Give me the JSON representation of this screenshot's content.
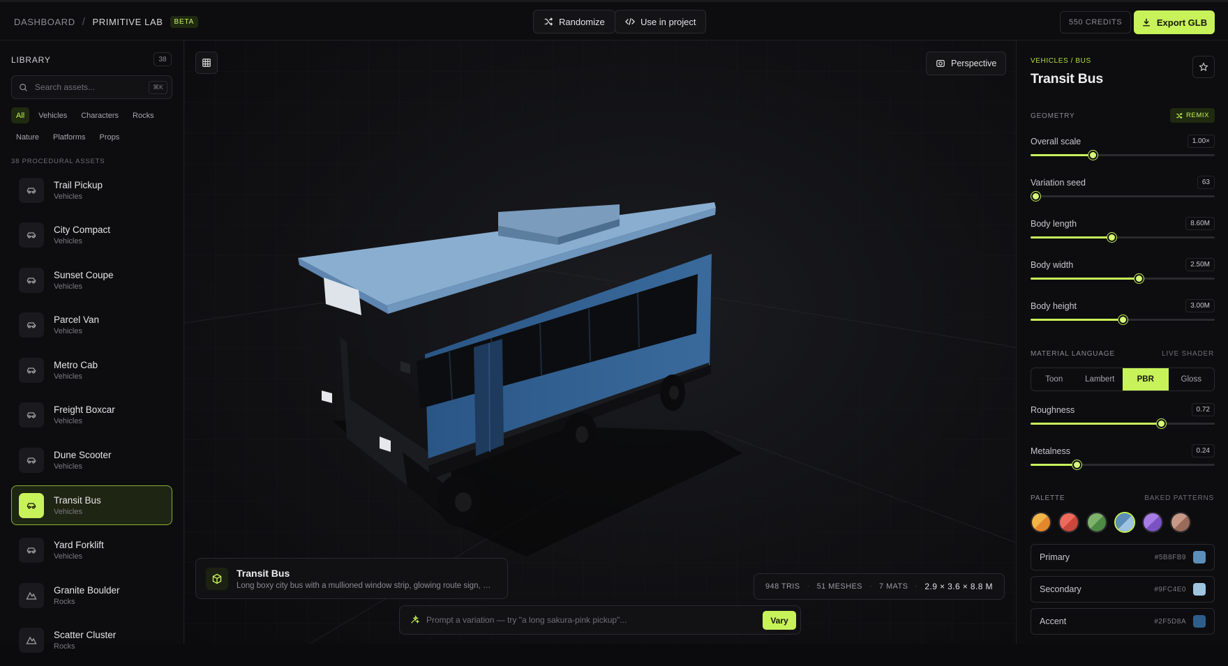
{
  "header": {
    "breadcrumb_root": "DASHBOARD",
    "breadcrumb_current": "PRIMITIVE LAB",
    "badge": "BETA",
    "randomize_label": "Randomize",
    "use_in_project_label": "Use in project",
    "credits": "550 CREDITS",
    "export_label": "Export GLB"
  },
  "library": {
    "title": "LIBRARY",
    "count": "38",
    "search_placeholder": "Search assets...",
    "search_shortcut": "⌘K",
    "filters": [
      {
        "label": "All",
        "active": true
      },
      {
        "label": "Vehicles"
      },
      {
        "label": "Characters"
      },
      {
        "label": "Rocks"
      },
      {
        "label": "Nature"
      },
      {
        "label": "Platforms"
      },
      {
        "label": "Props"
      }
    ],
    "assets_heading": "38 PROCEDURAL ASSETS",
    "assets": [
      {
        "name": "Trail Pickup",
        "category": "Vehicles",
        "icon": "car-icon"
      },
      {
        "name": "City Compact",
        "category": "Vehicles",
        "icon": "car-icon"
      },
      {
        "name": "Sunset Coupe",
        "category": "Vehicles",
        "icon": "car-icon"
      },
      {
        "name": "Parcel Van",
        "category": "Vehicles",
        "icon": "car-icon"
      },
      {
        "name": "Metro Cab",
        "category": "Vehicles",
        "icon": "car-icon"
      },
      {
        "name": "Freight Boxcar",
        "category": "Vehicles",
        "icon": "car-icon"
      },
      {
        "name": "Dune Scooter",
        "category": "Vehicles",
        "icon": "car-icon"
      },
      {
        "name": "Transit Bus",
        "category": "Vehicles",
        "icon": "car-icon",
        "selected": true
      },
      {
        "name": "Yard Forklift",
        "category": "Vehicles",
        "icon": "car-icon"
      },
      {
        "name": "Granite Boulder",
        "category": "Rocks",
        "icon": "mountain-icon"
      },
      {
        "name": "Scatter Cluster",
        "category": "Rocks",
        "icon": "mountain-icon"
      }
    ]
  },
  "viewport": {
    "camera_label": "Perspective",
    "info_title": "Transit Bus",
    "info_desc": "Long boxy city bus with a mullioned window strip, glowing route sign, sliding doors and chunky wheels",
    "stats": {
      "tris": "948 TRIS",
      "meshes": "51 MESHES",
      "mats": "7 MATS",
      "dims": "2.9 × 3.6 × 8.8 M"
    },
    "prompt_placeholder": "Prompt a variation — try \"a long sakura-pink pickup\"...",
    "vary_label": "Vary"
  },
  "inspector": {
    "crumb": "VEHICLES / BUS",
    "title": "Transit Bus",
    "geometry_heading": "GEOMETRY",
    "remix_label": "REMIX",
    "geometry": [
      {
        "label": "Overall scale",
        "value": "1.00×",
        "fraction": 0.34
      },
      {
        "label": "Variation seed",
        "value": "63",
        "fraction": 0.03
      },
      {
        "label": "Body length",
        "value": "8.60M",
        "fraction": 0.44
      },
      {
        "label": "Body width",
        "value": "2.50M",
        "fraction": 0.59
      },
      {
        "label": "Body height",
        "value": "3.00M",
        "fraction": 0.5
      }
    ],
    "material_heading": "MATERIAL LANGUAGE",
    "material_badge": "LIVE SHADER",
    "materials": [
      {
        "label": "Toon"
      },
      {
        "label": "Lambert"
      },
      {
        "label": "PBR",
        "active": true
      },
      {
        "label": "Gloss"
      }
    ],
    "surface": [
      {
        "label": "Roughness",
        "value": "0.72",
        "fraction": 0.71
      },
      {
        "label": "Metalness",
        "value": "0.24",
        "fraction": 0.25
      }
    ],
    "palette_heading": "PALETTE",
    "palette_badge": "BAKED PATTERNS",
    "swatches": [
      {
        "a": "#f2b548",
        "b": "#e3872c"
      },
      {
        "a": "#ee6a5c",
        "b": "#c9473b"
      },
      {
        "a": "#7fb26b",
        "b": "#4d8a43"
      },
      {
        "a": "#5b8fb9",
        "b": "#9fc4e0",
        "selected": true
      },
      {
        "a": "#a87ce6",
        "b": "#7a52c4"
      },
      {
        "a": "#c79a87",
        "b": "#9a6b58"
      }
    ],
    "colors": [
      {
        "name": "Primary",
        "hex": "#5B8FB9",
        "color": "#5b8fb9"
      },
      {
        "name": "Secondary",
        "hex": "#9FC4E0",
        "color": "#9fc4e0"
      },
      {
        "name": "Accent",
        "hex": "#2F5D8A",
        "color": "#2f5d8a"
      }
    ]
  }
}
